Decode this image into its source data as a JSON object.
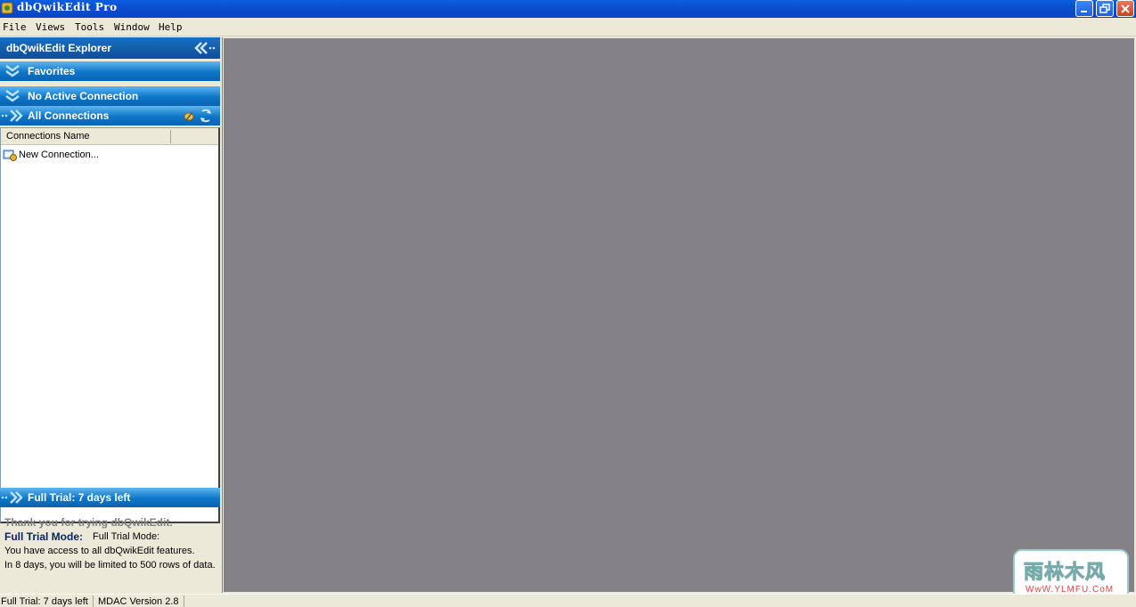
{
  "window": {
    "title": "dbQwikEdit Pro"
  },
  "menu": {
    "items": [
      "File",
      "Views",
      "Tools",
      "Window",
      "Help"
    ]
  },
  "explorer": {
    "title": "dbQwikEdit Explorer",
    "sections": {
      "favorites": "Favorites",
      "active_connection": "No Active Connection",
      "all_connections": "All Connections"
    },
    "grid": {
      "column_header": "Connections Name",
      "rows": [
        "New Connection..."
      ]
    },
    "trial": {
      "bar_label": "Full Trial: 7 days left",
      "thanks": "Thank you for trying dbQwikEdit.",
      "mode_label": "Full Trial Mode:",
      "mode_value": "Full Trial Mode:",
      "access": "You have access to all dbQwikEdit features.",
      "limit": "In 8 days, you will be limited to 500 rows of data."
    }
  },
  "statusbar": {
    "trial": "Full Trial: 7 days left",
    "mdac": "MDAC Version 2.8"
  },
  "watermark": {
    "brand": "雨林木风",
    "url": "WwW.YLMFU.CoM"
  },
  "icons": {
    "app": "app-icon",
    "minimize": "minimize-icon",
    "restore": "restore-icon",
    "close": "close-icon",
    "collapse": "double-chevron-left-icon",
    "expand": "double-chevron-down-icon",
    "arrow": "double-chevron-right-icon",
    "new_connection": "new-connection-icon",
    "edit": "pencil-icon",
    "refresh": "refresh-icon"
  },
  "colors": {
    "titlebar": "#0b4ecf",
    "section_bar": "#0d76c8",
    "workspace": "#858287",
    "chrome": "#ece9d8"
  }
}
